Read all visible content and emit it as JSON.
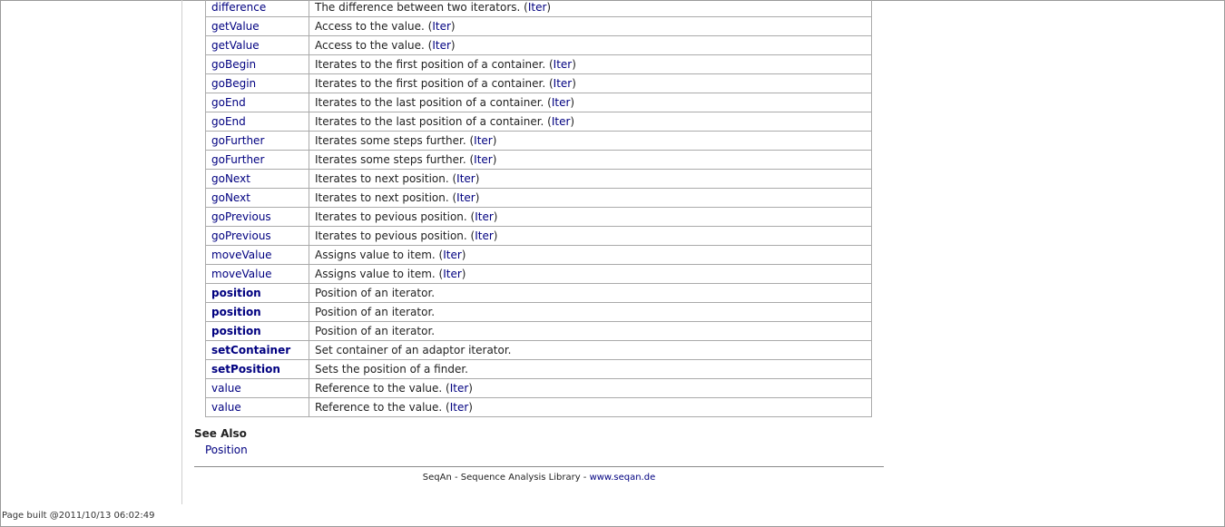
{
  "functions": [
    {
      "name": "difference",
      "bold": false,
      "description": "The difference between two iterators. (",
      "class_link": "Iter",
      "suffix": ")"
    },
    {
      "name": "getValue",
      "bold": false,
      "description": "Access to the value. (",
      "class_link": "Iter",
      "suffix": ")"
    },
    {
      "name": "getValue",
      "bold": false,
      "description": "Access to the value. (",
      "class_link": "Iter",
      "suffix": ")"
    },
    {
      "name": "goBegin",
      "bold": false,
      "description": "Iterates to the first position of a container. (",
      "class_link": "Iter",
      "suffix": ")"
    },
    {
      "name": "goBegin",
      "bold": false,
      "description": "Iterates to the first position of a container. (",
      "class_link": "Iter",
      "suffix": ")"
    },
    {
      "name": "goEnd",
      "bold": false,
      "description": "Iterates to the last position of a container. (",
      "class_link": "Iter",
      "suffix": ")"
    },
    {
      "name": "goEnd",
      "bold": false,
      "description": "Iterates to the last position of a container. (",
      "class_link": "Iter",
      "suffix": ")"
    },
    {
      "name": "goFurther",
      "bold": false,
      "description": "Iterates some steps further. (",
      "class_link": "Iter",
      "suffix": ")"
    },
    {
      "name": "goFurther",
      "bold": false,
      "description": "Iterates some steps further. (",
      "class_link": "Iter",
      "suffix": ")"
    },
    {
      "name": "goNext",
      "bold": false,
      "description": "Iterates to next position. (",
      "class_link": "Iter",
      "suffix": ")"
    },
    {
      "name": "goNext",
      "bold": false,
      "description": "Iterates to next position. (",
      "class_link": "Iter",
      "suffix": ")"
    },
    {
      "name": "goPrevious",
      "bold": false,
      "description": "Iterates to pevious position. (",
      "class_link": "Iter",
      "suffix": ")"
    },
    {
      "name": "goPrevious",
      "bold": false,
      "description": "Iterates to pevious position. (",
      "class_link": "Iter",
      "suffix": ")"
    },
    {
      "name": "moveValue",
      "bold": false,
      "description": "Assigns value to item. (",
      "class_link": "Iter",
      "suffix": ")"
    },
    {
      "name": "moveValue",
      "bold": false,
      "description": "Assigns value to item. (",
      "class_link": "Iter",
      "suffix": ")"
    },
    {
      "name": "position",
      "bold": true,
      "description": "Position of an iterator.",
      "class_link": "",
      "suffix": ""
    },
    {
      "name": "position",
      "bold": true,
      "description": "Position of an iterator.",
      "class_link": "",
      "suffix": ""
    },
    {
      "name": "position",
      "bold": true,
      "description": "Position of an iterator.",
      "class_link": "",
      "suffix": ""
    },
    {
      "name": "setContainer",
      "bold": true,
      "description": "Set container of an adaptor iterator.",
      "class_link": "",
      "suffix": ""
    },
    {
      "name": "setPosition",
      "bold": true,
      "description": "Sets the position of a finder.",
      "class_link": "",
      "suffix": ""
    },
    {
      "name": "value",
      "bold": false,
      "description": "Reference to the value. (",
      "class_link": "Iter",
      "suffix": ")"
    },
    {
      "name": "value",
      "bold": false,
      "description": "Reference to the value. (",
      "class_link": "Iter",
      "suffix": ")"
    }
  ],
  "see_also": {
    "heading": "See Also",
    "link": "Position"
  },
  "footer": {
    "text": "SeqAn - Sequence Analysis Library - ",
    "link": "www.seqan.de"
  },
  "build_info": "Page built @2011/10/13 06:02:49",
  "colors": {
    "link": "#000080",
    "text": "#222222",
    "border": "#aaaaaa"
  }
}
